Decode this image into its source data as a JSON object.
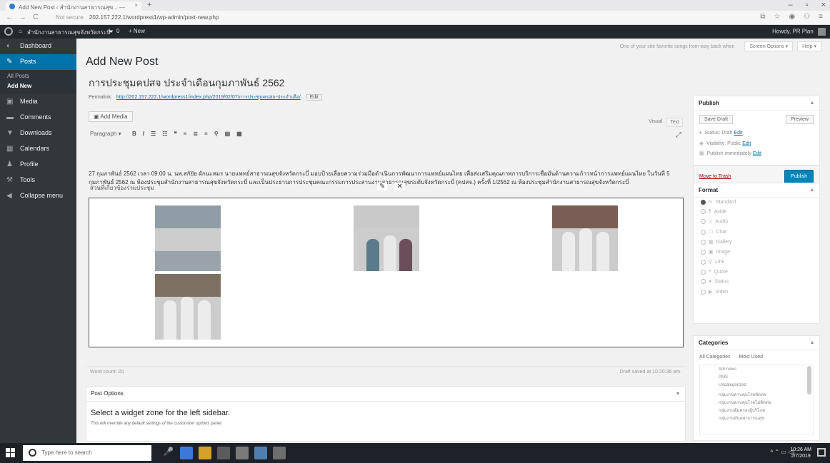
{
  "browser": {
    "tab_title": "Add New Post ‹ สำนักงานสาธารณสุข... — ",
    "url_warning": "Not secure",
    "url": "202.157.222.1/wordpress1/wp-admin/post-new.php"
  },
  "adminbar": {
    "site_name": "สำนักงานสาธารณสุขจังหวัดกระบี่",
    "comments_count": "0",
    "new_label": "+ New",
    "howdy": "Howdy, PR Plan"
  },
  "sidebar": {
    "items": [
      {
        "label": "Dashboard",
        "icon": "dashboard-icon"
      },
      {
        "label": "Posts",
        "icon": "pin-icon"
      },
      {
        "label": "Media",
        "icon": "media-icon"
      },
      {
        "label": "Comments",
        "icon": "comment-icon"
      },
      {
        "label": "Downloads",
        "icon": "download-icon"
      },
      {
        "label": "Calendars",
        "icon": "calendar-icon"
      },
      {
        "label": "Profile",
        "icon": "user-icon"
      },
      {
        "label": "Tools",
        "icon": "wrench-icon"
      },
      {
        "label": "Collapse menu",
        "icon": "collapse-icon"
      }
    ],
    "posts_sub": [
      "All Posts",
      "Add New"
    ]
  },
  "screen_meta": {
    "tip": "One of your site favorite songs from way back when",
    "screen_options": "Screen Options ▾",
    "help": "Help ▾"
  },
  "page_title": "Add New Post",
  "post": {
    "title": "การประชุมคปสจ ประจำเดือนกุมภาพันธ์ 2562",
    "permalink_label": "Permalink:",
    "permalink_url": "http://202.157.222.1/wordpress1/index.php/2019/02/07/การประชุมคปสจ-ประจำเดือ/",
    "edit_label": "Edit",
    "add_media": "Add Media",
    "visual_tab": "Visual",
    "text_tab": "Text",
    "format_select": "Paragraph ▾",
    "content": "27 กุมภาพันธ์ 2562 เวลา 09.00 น. นพ.สกัยัย ผักนะหมร นายแพทย์สาธารณสุขจังหวัดกระบี่ มอบป้ายเลื่อยความร่วมมือดำเนินการพัฒนาการแพทย์แผนไทย เพื่อส่งเสริมคุณภาพการบริการเชื่อมั่นด้านความก้าวหน้าการแพทย์แผนไทย ในวันที่ 5 กุมภาพันธ์ 2562 ณ ห้องประชุมสำนักงานสาธารณสุขจังหวัดกระบี่ และเป็นประธานการประชุมคณะกรรมการประสานงานสาธารณสุขระดับจังหวัดกระบี่ (คปสจ.) ครั้งที่ 1/2562 ณ ห้องประชุมสำนักงานสาธารณสุขจังหวัดกระบี่",
    "gallery_label": "ส่วนที่เกี่ยวข้องร่วมประชุม",
    "word_count": "Word count: 20",
    "draft_saved": "Draft saved at 10:20:36 am."
  },
  "post_options": {
    "title": "Post Options",
    "widget_title": "Select a widget zone for the left sidebar.",
    "widget_desc": "This will override any default settings of the customizer options panel."
  },
  "publish_box": {
    "title": "Publish",
    "save_draft": "Save Draft",
    "preview": "Preview",
    "status": "Status: Draft",
    "visibility": "Visibility: Public",
    "schedule": "Publish immediately",
    "edit": "Edit",
    "trash": "Move to Trash",
    "publish": "Publish"
  },
  "format_box": {
    "title": "Format",
    "options": [
      "Standard",
      "Aside",
      "Audio",
      "Chat",
      "Gallery",
      "Image",
      "Link",
      "Quote",
      "Status",
      "Video"
    ]
  },
  "categories_box": {
    "title": "Categories",
    "tab_all": "All Categories",
    "tab_used": "Most Used",
    "items": [
      "Adr news",
      "PMS",
      "Uncategorized",
      "กลุ่มงานควบคุมโรคติดต่อ",
      "กลุ่มงานควบคุมโรคไม่ติดต่อ",
      "กลุ่มงานคุ้มครองผู้บริโภค",
      "กลุ่มงานทันตสาธารณสุข"
    ]
  },
  "taskbar": {
    "search_placeholder": "Type here to search",
    "time": "10:26 AM",
    "date": "2/7/2019"
  },
  "colors": {
    "admin_sidebar": "#32373c",
    "admin_accent": "#0073aa",
    "publish_button": "#0085ba"
  }
}
